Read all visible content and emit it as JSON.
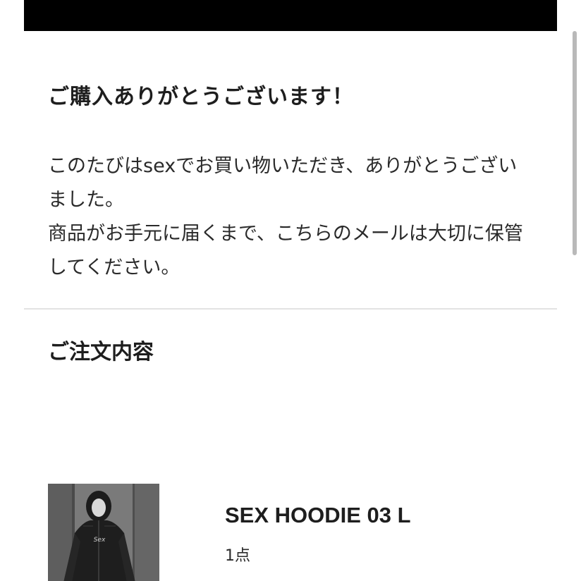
{
  "email": {
    "heading": "ご購入ありがとうございます！",
    "message_lines": [
      "このたびはsexでお買い物いただき、ありがとうございました。",
      "商品がお手元に届くまで、こちらのメールは大切に保管してください。"
    ]
  },
  "order": {
    "section_title": "ご注文内容",
    "items": [
      {
        "name": "SEX HOODIE 03 L",
        "quantity": "1点",
        "thumbnail_icon": "hoodie-photo"
      }
    ]
  },
  "colors": {
    "top_bar": "#000000",
    "divider": "#e3e3e3",
    "text": "#222222"
  }
}
